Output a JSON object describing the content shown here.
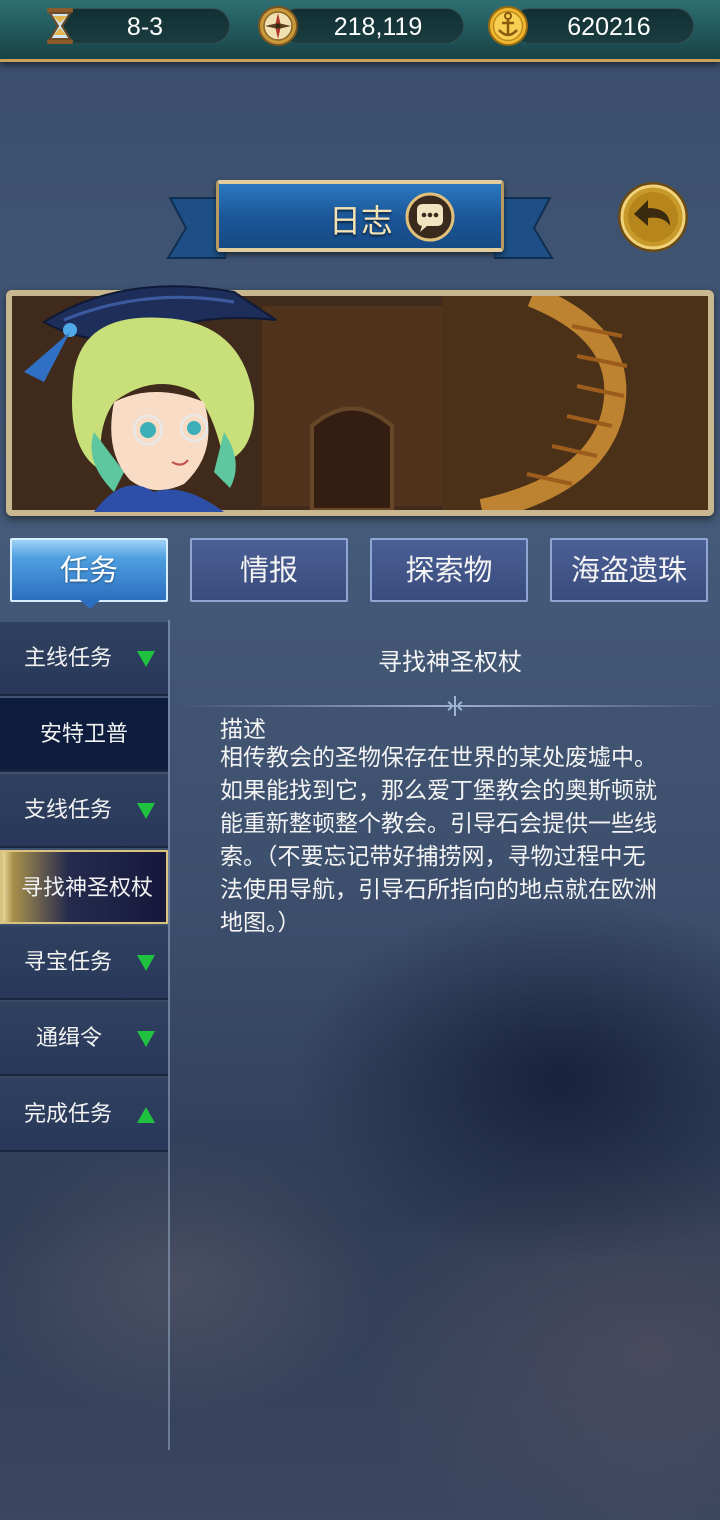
{
  "resources": {
    "stage": "8-3",
    "compass_value": "218,119",
    "gold_value": "620216",
    "icons": [
      "hourglass-icon",
      "compass-icon",
      "anchor-coin-icon"
    ]
  },
  "header": {
    "title": "日志",
    "chat_icon": "speech-bubble-icon",
    "back_icon": "back-arrow-icon"
  },
  "tabs": [
    {
      "label": "任务",
      "active": true
    },
    {
      "label": "情报",
      "active": false
    },
    {
      "label": "探索物",
      "active": false
    },
    {
      "label": "海盗遗珠",
      "active": false
    }
  ],
  "sidebar": {
    "items": [
      {
        "label": "主线任务",
        "type": "category",
        "arrow": "down"
      },
      {
        "label": "安特卫普",
        "type": "sub"
      },
      {
        "label": "支线任务",
        "type": "category",
        "arrow": "down"
      },
      {
        "label": "寻找神圣权杖",
        "type": "sub",
        "selected": true
      },
      {
        "label": "寻宝任务",
        "type": "category",
        "arrow": "down"
      },
      {
        "label": "通缉令",
        "type": "category",
        "arrow": "down"
      },
      {
        "label": "完成任务",
        "type": "category",
        "arrow": "up"
      }
    ]
  },
  "quest": {
    "title": "寻找神圣权杖",
    "desc_label": "描述",
    "description": "相传教会的圣物保存在世界的某处废墟中。如果能找到它，那么爱丁堡教会的奥斯顿就能重新整顿整个教会。引导石会提供一些线索。（不要忘记带好捕捞网，寻物过程中无法使用导航，引导石所指向的地点就在欧洲地图。）"
  },
  "colors": {
    "accent_gold": "#c8a25a",
    "arrow_green": "#20c040",
    "tab_active": "#2c6fc0"
  }
}
